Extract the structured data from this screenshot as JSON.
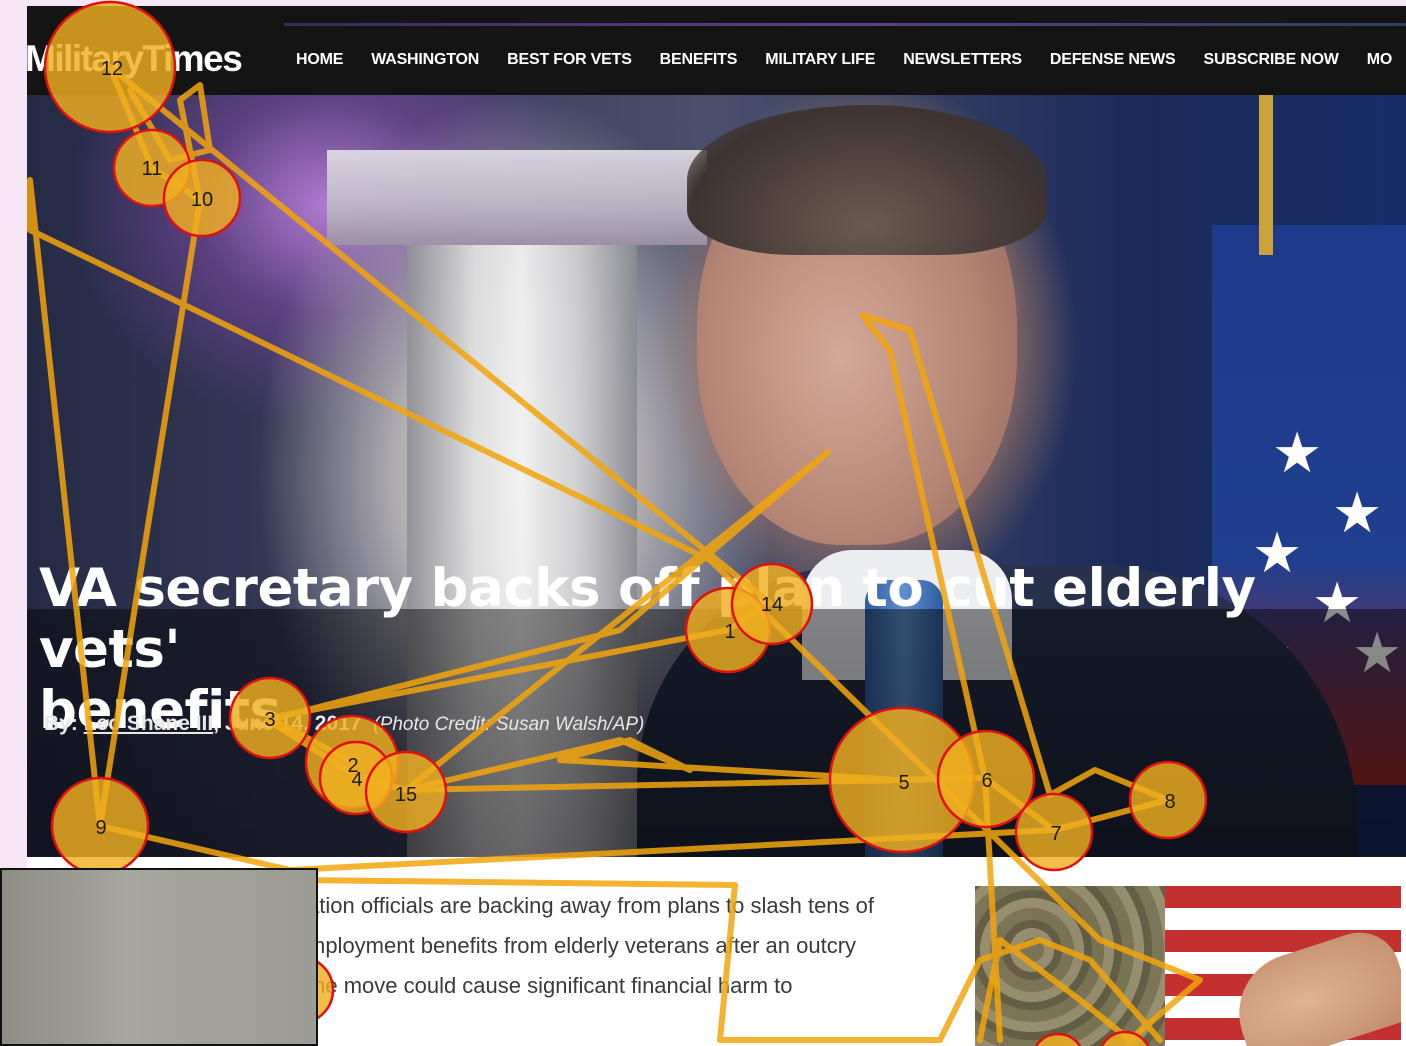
{
  "header": {
    "logo_text": "MilitaryTimes",
    "nav_items": [
      "HOME",
      "WASHINGTON",
      "BEST FOR VETS",
      "BENEFITS",
      "MILITARY LIFE",
      "NEWSLETTERS",
      "DEFENSE NEWS",
      "SUBSCRIBE NOW",
      "MO"
    ]
  },
  "article": {
    "headline_line1": "VA secretary backs off plan to cut elderly vets'",
    "headline_line2": "benefits",
    "byline_prefix": "By: ",
    "author": "Leo Shane III",
    "date": ", June 14, 2017",
    "photo_credit": "(Photo Credit: Susan Walsh/AP)",
    "body_lines": [
      "ation officials are backing away from plans to slash tens of",
      "mployment benefits from elderly veterans after an outcry",
      "the move could cause significant financial harm to"
    ]
  },
  "gaze_overlay": {
    "fixation_labels": [
      "1",
      "2",
      "3",
      "4",
      "5",
      "6",
      "7",
      "8",
      "9",
      "10",
      "11",
      "12",
      "14",
      "15"
    ],
    "colors": {
      "fill": "#f0b020",
      "stroke": "#e01010",
      "path": "#f2a50c"
    }
  },
  "colors": {
    "page_background": "#f6e6f6",
    "topbar": "#141414"
  }
}
